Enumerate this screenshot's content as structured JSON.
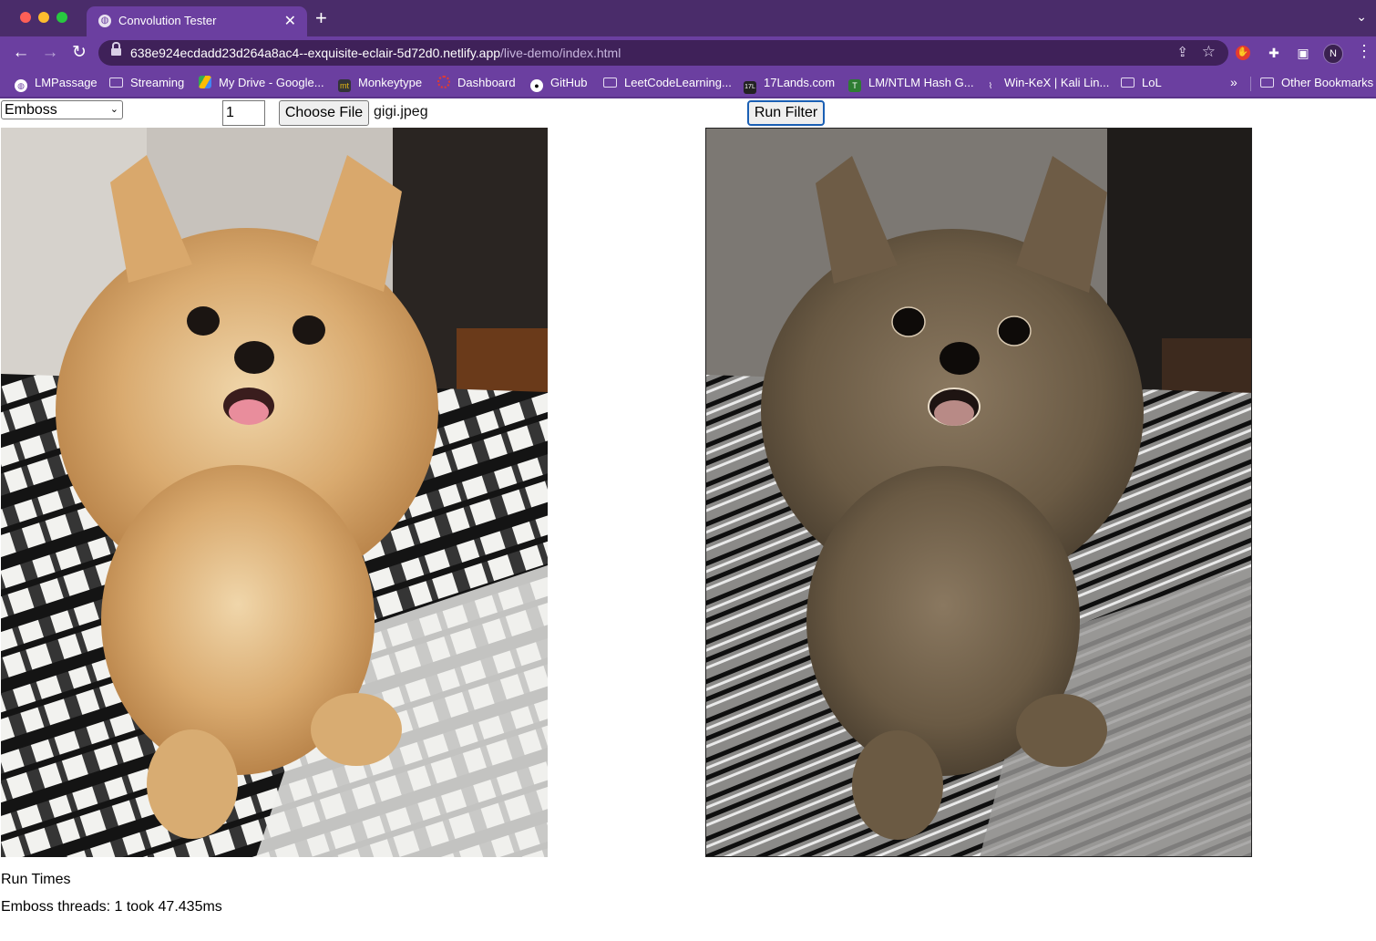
{
  "browser": {
    "tab_title": "Convolution Tester",
    "url_host": "638e924ecdadd23d264a8ac4--exquisite-eclair-5d72d0.netlify.app",
    "url_path": "/live-demo/index.html",
    "profile_initial": "N",
    "bookmarks": [
      {
        "label": "LMPassage",
        "icon": "globe-icon"
      },
      {
        "label": "Streaming",
        "icon": "folder-icon"
      },
      {
        "label": "My Drive - Google...",
        "icon": "drive-icon"
      },
      {
        "label": "Monkeytype",
        "icon": "monkeytype-icon"
      },
      {
        "label": "Dashboard",
        "icon": "dashboard-icon"
      },
      {
        "label": "GitHub",
        "icon": "github-icon"
      },
      {
        "label": "LeetCodeLearning...",
        "icon": "folder-icon"
      },
      {
        "label": "17Lands.com",
        "icon": "17lands-icon"
      },
      {
        "label": "LM/NTLM Hash G...",
        "icon": "t-icon"
      },
      {
        "label": "Win-KeX | Kali Lin...",
        "icon": "kali-icon"
      },
      {
        "label": "LoL",
        "icon": "folder-icon"
      }
    ],
    "other_bookmarks": "Other Bookmarks",
    "bookmarks_more": "»"
  },
  "controls": {
    "filter_selected": "Emboss",
    "thread_count": "1",
    "choose_file_label": "Choose File",
    "file_name": "gigi.jpeg",
    "run_label": "Run Filter"
  },
  "results": {
    "heading": "Run Times",
    "line": "Emboss threads: 1 took 47.435ms"
  }
}
